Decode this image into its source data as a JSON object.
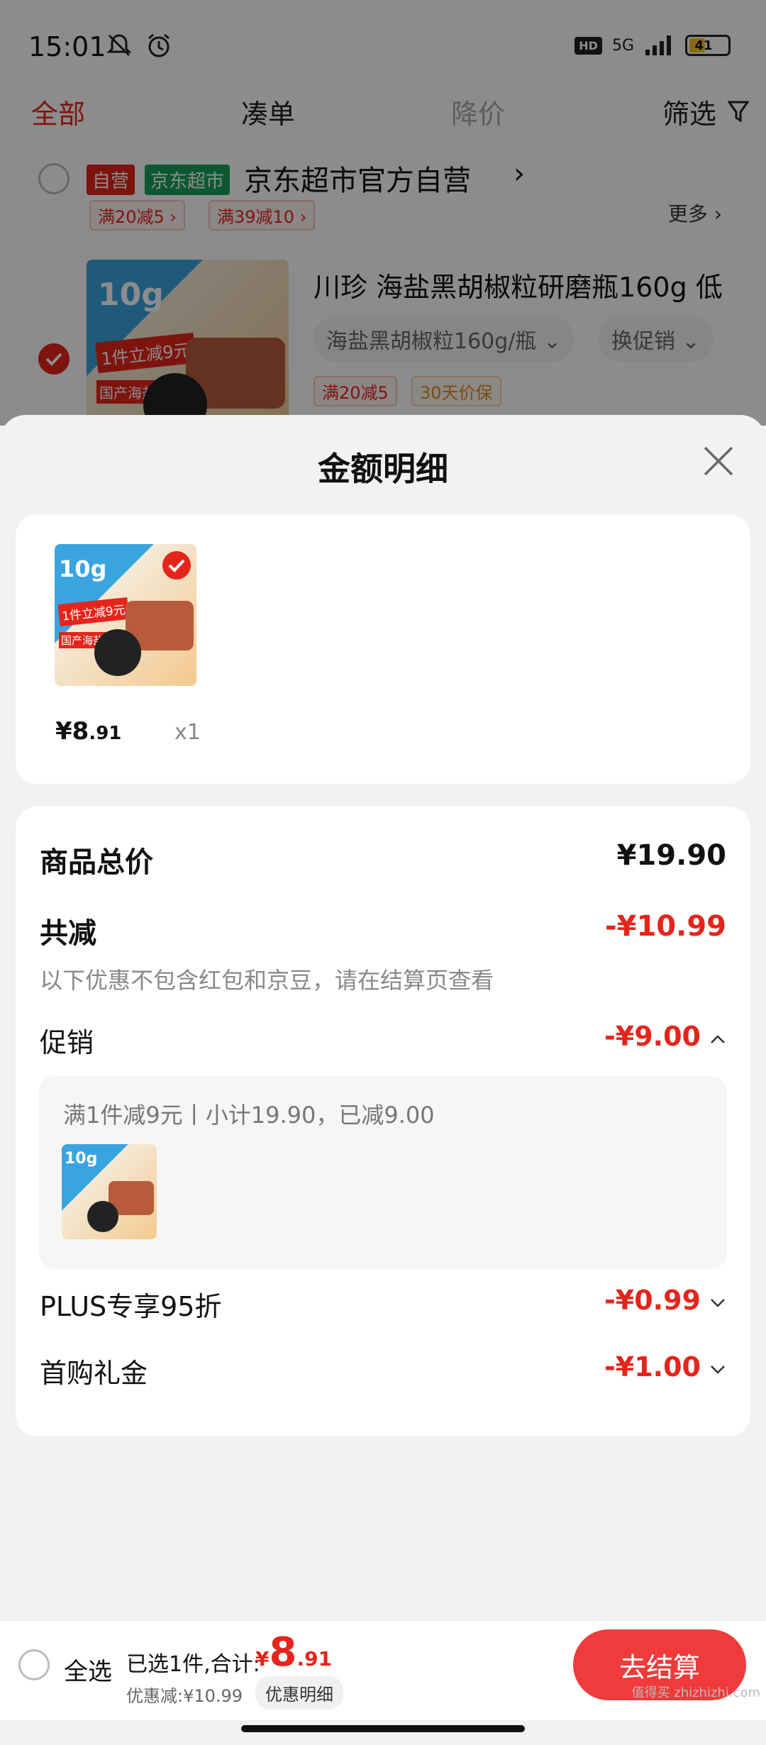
{
  "status_bar": {
    "time": "15:01",
    "network": "5G",
    "hd": "HD",
    "battery": "41"
  },
  "tabs": [
    {
      "label": "全部",
      "state": "active"
    },
    {
      "label": "凑单",
      "state": "normal"
    },
    {
      "label": "降价",
      "state": "disabled"
    },
    {
      "label": "筛选",
      "state": "normal"
    }
  ],
  "store": {
    "tag_self": "自营",
    "tag_market": "京东超市",
    "name": "京东超市官方自营",
    "chevron": "›",
    "promo_1": "满20减5 ›",
    "promo_2": "满39减10 ›",
    "more": "更多 ›"
  },
  "product": {
    "title": "川珍 海盐黑胡椒粒研磨瓶160g 低",
    "spec_chip": "海盐黑胡椒粒160g/瓶 ⌄",
    "promo_chip": "换促销 ⌄",
    "badge_1": "满20减5",
    "badge_2": "30天价保",
    "image_text": "10g",
    "image_text_2": "1件立减9元",
    "image_text_3": "国产海盐"
  },
  "sheet": {
    "title": "金额明细",
    "item_price_main": "¥8",
    "item_price_decimal": ".91",
    "item_qty": "x1",
    "total_label": "商品总价",
    "total_value": "¥19.90",
    "discount_label": "共减",
    "discount_value": "-¥10.99",
    "discount_note": "以下优惠不包含红包和京豆，请在结算页查看",
    "promo_label": "促销",
    "promo_value": "-¥9.00",
    "promo_detail": "满1件减9元丨小计19.90，已减9.00",
    "plus_label": "PLUS专享95折",
    "plus_value": "-¥0.99",
    "first_label": "首购礼金",
    "first_value": "-¥1.00"
  },
  "checkout": {
    "select_all": "全选",
    "selected_prefix": "已选1件,合计:",
    "total_symbol": "¥",
    "total_main": "8",
    "total_decimal": ".91",
    "saved": "优惠减:¥10.99",
    "detail_button": "优惠明细",
    "submit": "去结算"
  },
  "watermark": "值得买 zhizhizhi.com",
  "colors": {
    "accent": "#e5251b",
    "market_green": "#1aa05a",
    "sheet_bg": "#f2f2f2"
  }
}
